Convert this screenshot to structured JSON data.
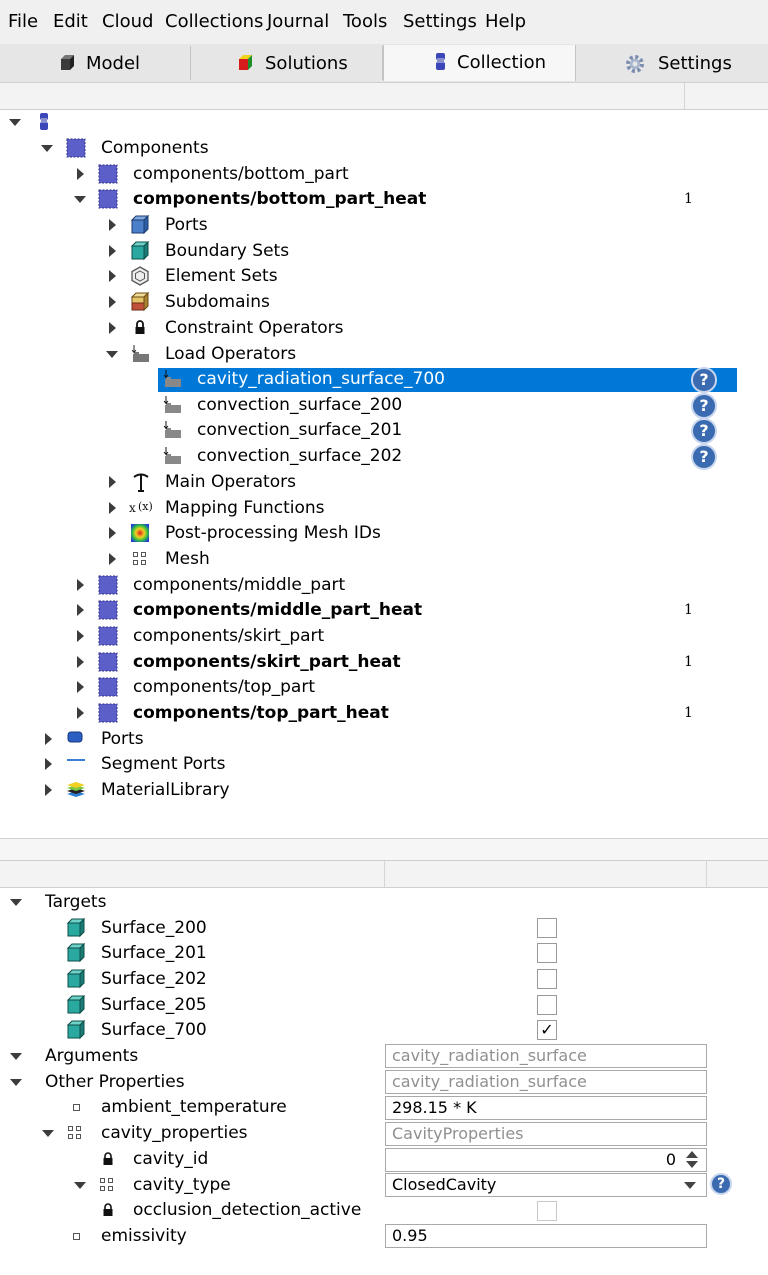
{
  "menu": [
    "File",
    "Edit",
    "Cloud",
    "Collections",
    "Journal",
    "Tools",
    "Settings",
    "Help"
  ],
  "tabs": [
    {
      "label": "Model",
      "icon": "cube-icon"
    },
    {
      "label": "Solutions",
      "icon": "colored-cube-icon"
    },
    {
      "label": "Collection",
      "icon": "collection-icon",
      "active": true
    },
    {
      "label": "Settings",
      "icon": "gear-icon"
    }
  ],
  "tree": {
    "components": "Components",
    "bottom_part": "components/bottom_part",
    "bottom_part_heat": "components/bottom_part_heat",
    "bottom_part_heat_count": "1",
    "ports": "Ports",
    "boundary_sets": "Boundary Sets",
    "element_sets": "Element Sets",
    "subdomains": "Subdomains",
    "constraint_operators": "Constraint Operators",
    "load_operators": "Load Operators",
    "load_items": [
      "cavity_radiation_surface_700",
      "convection_surface_200",
      "convection_surface_201",
      "convection_surface_202"
    ],
    "main_operators": "Main Operators",
    "mapping_functions": "Mapping Functions",
    "postprocessing_mesh_ids": "Post-processing Mesh IDs",
    "mesh": "Mesh",
    "middle_part": "components/middle_part",
    "middle_part_heat": "components/middle_part_heat",
    "middle_part_heat_count": "1",
    "skirt_part": "components/skirt_part",
    "skirt_part_heat": "components/skirt_part_heat",
    "skirt_part_heat_count": "1",
    "top_part": "components/top_part",
    "top_part_heat": "components/top_part_heat",
    "top_part_heat_count": "1",
    "root_ports": "Ports",
    "segment_ports": "Segment Ports",
    "material_library": "MaterialLibrary"
  },
  "properties": {
    "targets": "Targets",
    "surfaces": [
      {
        "name": "Surface_200",
        "checked": false
      },
      {
        "name": "Surface_201",
        "checked": false
      },
      {
        "name": "Surface_202",
        "checked": false
      },
      {
        "name": "Surface_205",
        "checked": false
      },
      {
        "name": "Surface_700",
        "checked": true
      }
    ],
    "checkmark": "✓",
    "arguments": "Arguments",
    "arguments_value": "cavity_radiation_surface",
    "other_properties": "Other Properties",
    "other_properties_value": "cavity_radiation_surface",
    "ambient_temperature": "ambient_temperature",
    "ambient_temperature_value": "298.15 * K",
    "cavity_properties": "cavity_properties",
    "cavity_properties_value": "CavityProperties",
    "cavity_id": "cavity_id",
    "cavity_id_value": "0",
    "cavity_type": "cavity_type",
    "cavity_type_value": "ClosedCavity",
    "occlusion_detection_active": "occlusion_detection_active",
    "emissivity": "emissivity",
    "emissivity_value": "0.95"
  },
  "help_glyph": "?",
  "colors": {
    "selection": "#0078d7",
    "teal": "#2aa9a0",
    "component": "#5b5fc7",
    "help": "#3a6ab0"
  }
}
